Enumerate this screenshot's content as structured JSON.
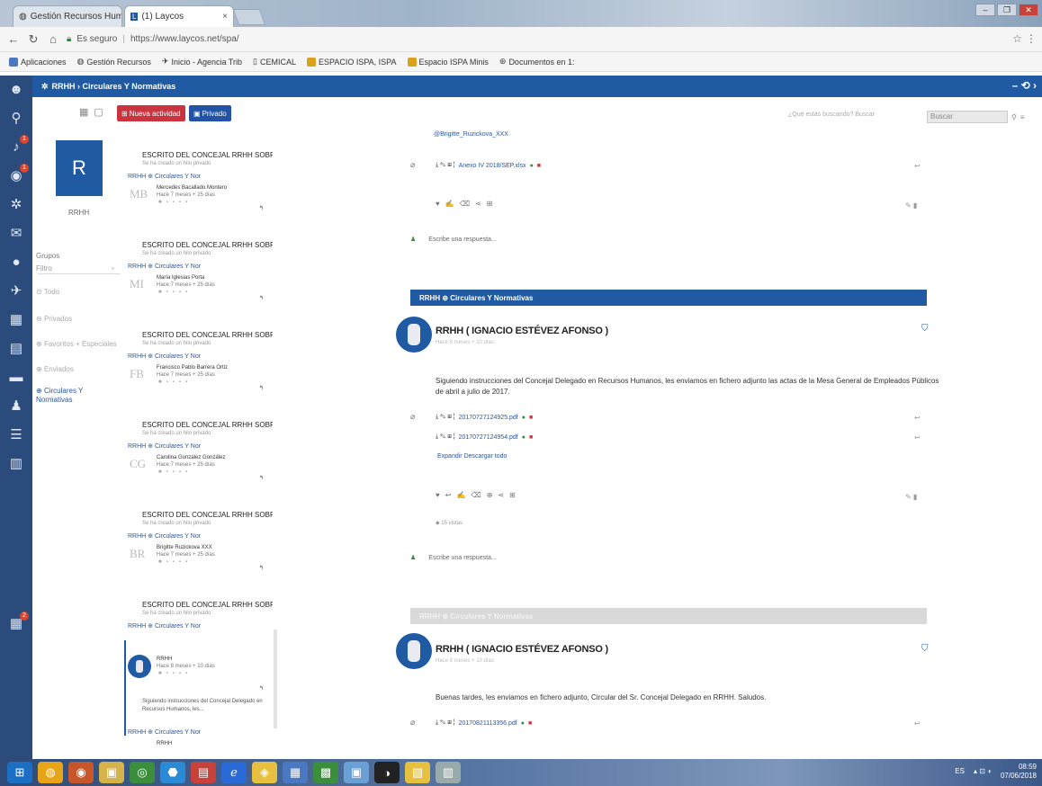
{
  "browser": {
    "tabs": [
      {
        "label": "Gestión Recursos Huma",
        "close": "×"
      },
      {
        "label": "(1) Laycos",
        "close": "×"
      }
    ],
    "address": {
      "secure_label": "Es seguro",
      "url": "https://www.laycos.net/spa/"
    },
    "bookmarks": [
      "Aplicaciones",
      "Gestión Recursos",
      "Inicio - Agencia Trib",
      "CEMICAL",
      "ESPACIO ISPA, ISPA",
      "Espacio ISPA Minis",
      "Documentos en 1:"
    ],
    "window_buttons": [
      "–",
      "❐",
      "✕"
    ]
  },
  "app": {
    "header_title": "RRHH › Circulares Y Normativas",
    "header_right": "– ⟲ ›",
    "iconbar": [
      {
        "icon": "user-icon",
        "glyph": "☻"
      },
      {
        "icon": "search-icon",
        "glyph": "⚲"
      },
      {
        "icon": "bell-icon",
        "glyph": "♪",
        "badge": "1"
      },
      {
        "icon": "broadcast-icon",
        "glyph": "◉",
        "badge": "1"
      },
      {
        "icon": "network-icon",
        "glyph": "✲"
      },
      {
        "icon": "mail-icon",
        "glyph": "✉"
      },
      {
        "icon": "chat-icon",
        "glyph": "●"
      },
      {
        "icon": "pin-icon",
        "glyph": "✈"
      },
      {
        "icon": "calendar-icon",
        "glyph": "▦"
      },
      {
        "icon": "document-icon",
        "glyph": "▤"
      },
      {
        "icon": "inbox-icon",
        "glyph": "▬"
      },
      {
        "icon": "people-icon",
        "glyph": "♟"
      },
      {
        "icon": "list-icon",
        "glyph": "☰"
      },
      {
        "icon": "report-icon",
        "glyph": "▥"
      }
    ],
    "bottom_icon": {
      "glyph": "▦",
      "badge": "2"
    }
  },
  "filters": {
    "avatar_letter": "R",
    "username": "RRHH",
    "groups_label": "Grupos",
    "filter_label": "Filtro",
    "items": [
      "Todo",
      "Privados",
      "Favoritos + Especiales",
      "Enviados",
      "Circulares Y Normativas"
    ]
  },
  "toolbar": {
    "new_activity": "Nueva actividad",
    "private": "Privado"
  },
  "feed": [
    {
      "title": "ESCRITO DEL CONCEJAL RRHH SOBRE ...",
      "sub": "Se ha creado un hilo privado",
      "group": "RRHH  ⊕ Circulares Y Nor",
      "initials": "MB",
      "name": "Mercedes Bacallado Montero",
      "time": "Hace 7 meses + 25 días"
    },
    {
      "title": "ESCRITO DEL CONCEJAL RRHH SOBRE ...",
      "sub": "Se ha creado un hilo privado",
      "group": "RRHH  ⊕ Circulares Y Nor",
      "initials": "MI",
      "name": "María Iglesias Porta",
      "time": "Hace 7 meses + 25 días"
    },
    {
      "title": "ESCRITO DEL CONCEJAL RRHH SOBRE ...",
      "sub": "Se ha creado un hilo privado",
      "group": "RRHH  ⊕ Circulares Y Nor",
      "initials": "FB",
      "name": "Francisco Pablo Barrera Ortiz",
      "time": "Hace 7 meses + 25 días"
    },
    {
      "title": "ESCRITO DEL CONCEJAL RRHH SOBRE ...",
      "sub": "Se ha creado un hilo privado",
      "group": "RRHH  ⊕ Circulares Y Nor",
      "initials": "CG",
      "name": "Carolina González González",
      "time": "Hace 7 meses + 25 días"
    },
    {
      "title": "ESCRITO DEL CONCEJAL RRHH SOBRE ...",
      "sub": "Se ha creado un hilo privado",
      "group": "RRHH  ⊕ Circulares Y Nor",
      "initials": "BR",
      "name": "Brigitte Ruzickova XXX",
      "time": "Hace 7 meses + 25 días"
    },
    {
      "title": "ESCRITO DEL CONCEJAL RRHH SOBRE ...",
      "sub": "Se ha creado un hilo privado",
      "group": "RRHH  ⊕ Circulares Y Nor",
      "initials": "",
      "name": "RRHH",
      "time": "Hace 8 meses + 10 días"
    }
  ],
  "feed_selected": {
    "name": "RRHH",
    "time": "Hace 8 meses + 10 días",
    "snippet": "Siguiendo instrucciones del Concejal Delegado en Recursos Humanos, les..."
  },
  "feed_last": {
    "group": "RRHH  ⊕ Circulares Y Nor",
    "name": "RRHH"
  },
  "search": {
    "placeholder": "Filtrar ...",
    "label": "Buscar",
    "hint": "¿Qué estás buscando?  Buscar"
  },
  "posts": {
    "top": {
      "author_link": "@Brigitte_Ruzickova_XXX",
      "file": "Anexo IV 2018/SEP.xlsx",
      "reply": "Escribe una respuesta..."
    },
    "p1": {
      "channel": "RRHH  ⊕ Circulares Y Normativas",
      "author": "RRHH ( IGNACIO ESTÉVEZ AFONSO )",
      "meta": "Hace 8 meses + 10 días",
      "body": "Siguiendo instrucciones del Concejal Delegado en Recursos Humanos, les enviamos en fichero adjunto las actas de la Mesa General de Empleados Públicos de abril a julio de 2017.",
      "files": [
        "20170727124925.pdf",
        "20170727124954.pdf"
      ],
      "links": "Expandir  Descargar todo",
      "seen": "15 vistas",
      "reply": "Escribe una respuesta..."
    },
    "p2": {
      "channel": "RRHH  ⊕ Circulares Y Normativas",
      "author": "RRHH ( IGNACIO ESTÉVEZ AFONSO )",
      "meta": "Hace 8 meses + 10 días",
      "body": "Buenas tardes, les enviamos en fichero adjunto, Circular del Sr. Concejal Delegado en RRHH. Saludos.",
      "file": "20170821113356.pdf"
    }
  },
  "taskbar": {
    "lang": "ES",
    "time": "08:59",
    "date": "07/06/2018",
    "apps": [
      "⊞",
      "◍",
      "◉",
      "▣",
      "◎",
      "⬣",
      "▤",
      "ℯ",
      "◈",
      "▦",
      "▩",
      "▣",
      "◑",
      "▧",
      "▥"
    ]
  },
  "colors": {
    "brand": "#1f5aa3",
    "danger": "#c9343f",
    "iconbar": "#2a4b7c"
  }
}
